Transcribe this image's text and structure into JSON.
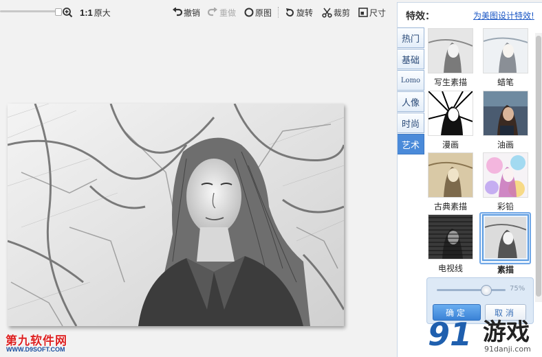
{
  "toolbar": {
    "zoom_ratio": "1:1",
    "original_size": "原大",
    "undo": "撤销",
    "redo": "重做",
    "original": "原图",
    "rotate": "旋转",
    "crop": "裁剪",
    "size": "尺寸"
  },
  "panel": {
    "title": "特效：",
    "link": "为美图设计特效!",
    "tabs": [
      "热门",
      "基础",
      "Lomo",
      "人像",
      "时尚",
      "艺术"
    ],
    "active_tab": "艺术",
    "effects": [
      {
        "name": "写生素描",
        "icon": "sketch-portrait-thumb"
      },
      {
        "name": "蜡笔",
        "icon": "crayon-portrait-thumb"
      },
      {
        "name": "漫画",
        "icon": "comic-portrait-thumb"
      },
      {
        "name": "油画",
        "icon": "oil-painting-portrait-thumb"
      },
      {
        "name": "古典素描",
        "icon": "classic-sketch-portrait-thumb"
      },
      {
        "name": "彩铅",
        "icon": "color-pencil-portrait-thumb"
      },
      {
        "name": "电视线",
        "icon": "tv-lines-portrait-thumb"
      },
      {
        "name": "素描",
        "icon": "pencil-sketch-portrait-thumb"
      }
    ],
    "selected_effect": "素描",
    "strength_percent": "75%",
    "strength_value": 0.75,
    "ok_label": "确定",
    "cancel_label": "取消"
  },
  "watermarks": {
    "left_title": "第九软件网",
    "left_url": "WWW.D9SOFT.COM",
    "right_logo": "91",
    "right_text": "游戏",
    "right_url": "91danji.com"
  },
  "colors": {
    "accent": "#4a8ad9",
    "link": "#1a56c4",
    "watermark_red": "#d22222",
    "watermark_blue": "#1f5fae"
  }
}
